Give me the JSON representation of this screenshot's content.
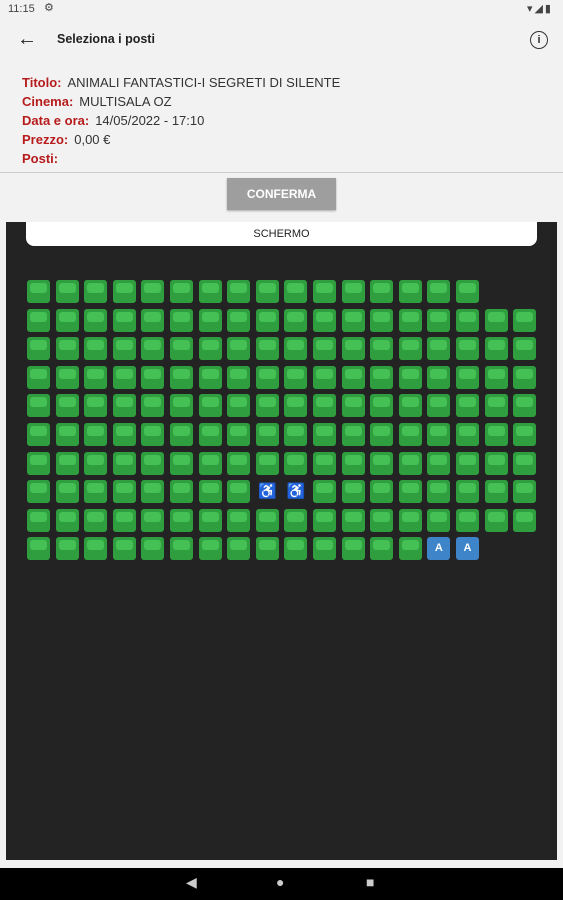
{
  "status_bar": {
    "time": "11:15",
    "settings_icon": "gear-icon",
    "icons": [
      "wifi-icon",
      "signal-icon",
      "battery-icon"
    ]
  },
  "app_bar": {
    "title": "Seleziona i posti",
    "back_icon": "arrow-back-icon",
    "info_icon": "info-icon"
  },
  "info": [
    {
      "label": "Titolo:",
      "value": "ANIMALI FANTASTICI-I SEGRETI DI SILENTE"
    },
    {
      "label": "Cinema:",
      "value": "MULTISALA OZ"
    },
    {
      "label": "Data e ora:",
      "value": "14/05/2022 - 17:10"
    },
    {
      "label": "Prezzo:",
      "value": "0,00 €"
    },
    {
      "label": "Posti:",
      "value": ""
    }
  ],
  "confirm_label": "CONFERMA",
  "screen_label": "SCHERMO",
  "seat_map": {
    "colors": {
      "available": "#45c055",
      "accessible": "#3d84c9",
      "occupied": "#ffffff",
      "background": "#232323"
    },
    "accessible_label": "A",
    "occupied_symbol": "wheelchair-pair-icon",
    "rows": [
      {
        "row": 1,
        "seats": 16
      },
      {
        "row": 2,
        "seats": 18
      },
      {
        "row": 3,
        "seats": 18
      },
      {
        "row": 4,
        "seats": 18
      },
      {
        "row": 5,
        "seats": 18
      },
      {
        "row": 6,
        "seats": 18
      },
      {
        "row": 7,
        "seats": 18
      },
      {
        "row": 8,
        "seats": 18,
        "occupied": [
          9,
          10
        ]
      },
      {
        "row": 9,
        "seats": 18
      },
      {
        "row": 10,
        "seats": 16,
        "accessible": [
          15,
          16
        ]
      }
    ]
  },
  "nav_bar": {
    "buttons": [
      "back-triangle-icon",
      "home-circle-icon",
      "recents-square-icon"
    ]
  }
}
